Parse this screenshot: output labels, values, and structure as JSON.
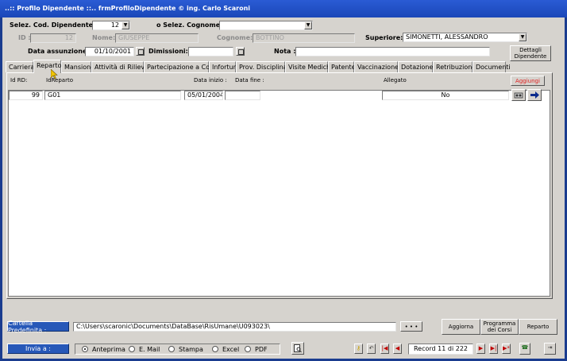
{
  "window": {
    "title": "..:: Profilo Dipendente ::..    frmProfiloDipendente © ing. Carlo Scaroni"
  },
  "header": {
    "cod_label": "Selez. Cod. Dipendente:",
    "cod_value": "12",
    "cognome_sel_label": "o Selez. Cognome",
    "cognome_sel_value": "",
    "id_label": "ID :",
    "id_value": "12",
    "nome_label": "Nome:",
    "nome_value": "GIUSEPPE",
    "cognome_label": "Cognome:",
    "cognome_value": "BOTTINO",
    "superiore_label": "Superiore:",
    "superiore_value": "SIMONETTI, ALESSANDRO",
    "assunzione_label": "Data assunzione:",
    "assunzione_value": "01/10/2001",
    "dimissioni_label": "Dimissioni:",
    "dimissioni_value": "",
    "nota_label": "Nota :",
    "nota_value": "",
    "dettagli_label": "Dettagli Dipendente"
  },
  "tabs": [
    {
      "label": "Carriera"
    },
    {
      "label": "Reparto"
    },
    {
      "label": "Mansione"
    },
    {
      "label": "Attività di Rilievo"
    },
    {
      "label": "Partecipazione a Corsi"
    },
    {
      "label": "Infortuni"
    },
    {
      "label": "Prov. Disciplinari"
    },
    {
      "label": "Visite Mediche"
    },
    {
      "label": "Patente"
    },
    {
      "label": "Vaccinazione"
    },
    {
      "label": "Dotazione"
    },
    {
      "label": "Retribuzione"
    },
    {
      "label": "Documenti"
    }
  ],
  "grid": {
    "columns": {
      "id_rd": "Id RD:",
      "id_reparto": "IdReparto",
      "data_inizio": "Data inizio :",
      "data_fine": "Data fine :",
      "allegato": "Allegato"
    },
    "add_label": "Aggiungi",
    "row": {
      "id_rd": "99",
      "id_reparto": "G01",
      "data_inizio": "05/01/2004",
      "data_fine": "",
      "allegato": "No"
    }
  },
  "footer": {
    "cartella_label": "Cartella Predefinita :",
    "cartella_value": "C:\\Users\\scaronic\\Documents\\DataBase\\RisUmane\\U093023\\",
    "browse_label": "• • •",
    "aggiorna_label": "Aggiorna",
    "programma_label": "Programma dei Corsi",
    "reparto_label": "Reparto",
    "invia_label": "Invia a :",
    "options": [
      "Anteprima",
      "E. Mail",
      "Stampa",
      "Excel",
      "PDF"
    ],
    "selected_option": "Anteprima",
    "record_label": "Record 11 di 222"
  },
  "colors": {
    "title_bar": "#1a47b8",
    "accent_blue": "#2758b8",
    "add_red": "#e02020",
    "nav_red": "#c00000"
  }
}
